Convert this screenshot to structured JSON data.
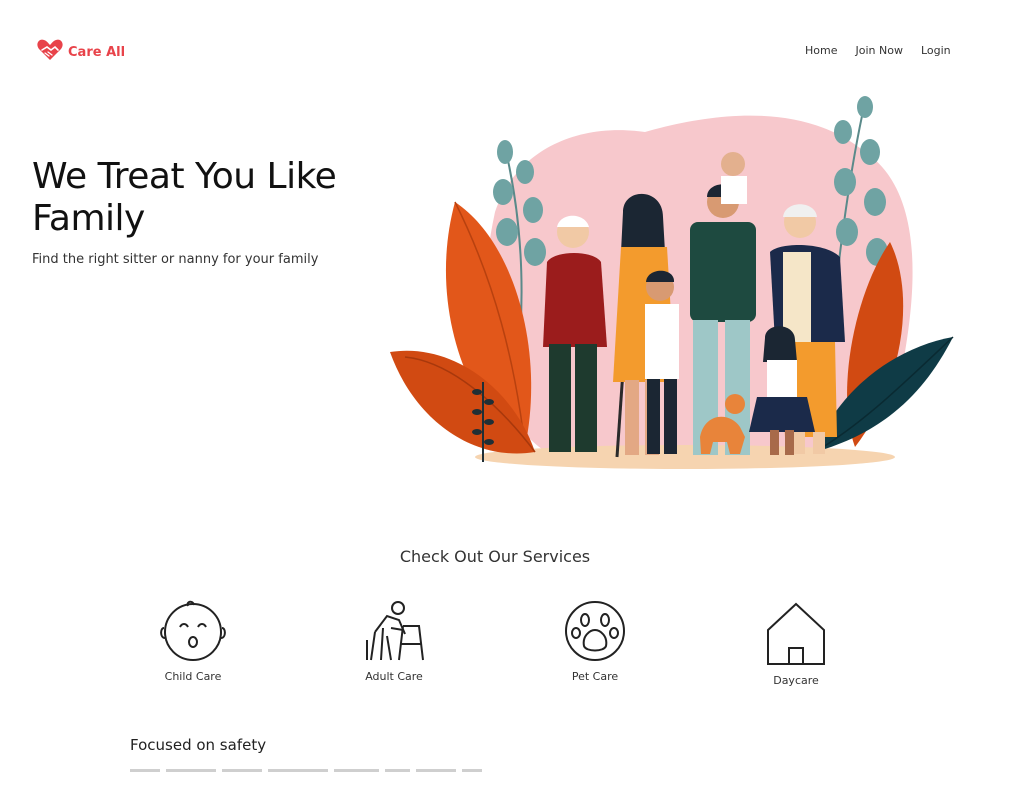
{
  "header": {
    "brand": "Care All",
    "brand_color": "#e8434a",
    "logo_icon": "heart-handshake-icon",
    "nav": [
      "Home",
      "Join Now",
      "Login"
    ]
  },
  "hero": {
    "title": "We Treat You Like Family",
    "subtitle": "Find the right sitter or nanny for your family",
    "illustration": "family-group-illustration"
  },
  "services": {
    "heading": "Check Out Our Services",
    "items": [
      {
        "label": "Child Care",
        "icon": "baby-face-icon"
      },
      {
        "label": "Adult Care",
        "icon": "elder-walker-icon"
      },
      {
        "label": "Pet Care",
        "icon": "paw-icon"
      },
      {
        "label": "Daycare",
        "icon": "house-icon"
      }
    ]
  },
  "safety": {
    "heading": "Focused on safety"
  },
  "colors": {
    "accent": "#e8434a",
    "blob": "#f7c8cc",
    "leaf_orange": "#e2571a",
    "leaf_dark": "#0f3b46"
  }
}
